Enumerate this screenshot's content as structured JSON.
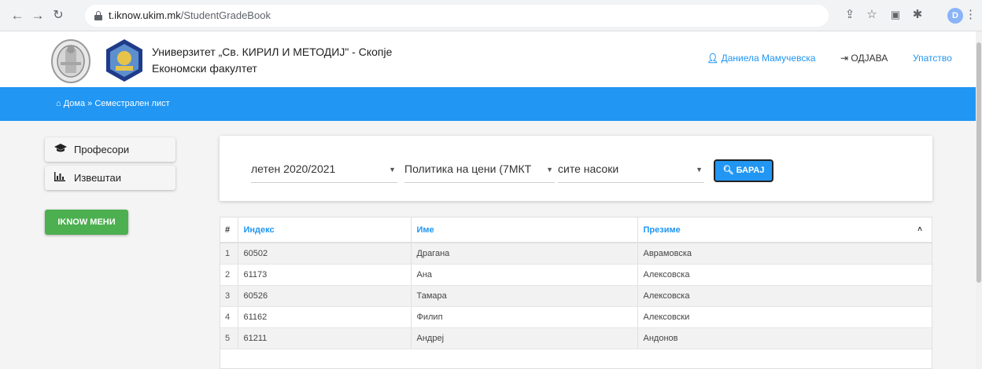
{
  "browser": {
    "url_host": "t.iknow.ukim.mk",
    "url_path": "/StudentGradeBook",
    "profile_letter": "D"
  },
  "header": {
    "university": "Универзитет „Св. КИРИЛ И МЕТОДИЈ\" - Скопје",
    "faculty": "Економски факултет",
    "user": "Даниела Мамучевска",
    "logout": "ОДЈАВА",
    "manual": "Упатство"
  },
  "breadcrumb": {
    "home": "Дома",
    "separator": "»",
    "current": "Семестрален лист"
  },
  "sidebar": {
    "items": [
      {
        "label": "Професори",
        "icon": "graduation-cap-icon"
      },
      {
        "label": "Извештаи",
        "icon": "bar-chart-icon"
      }
    ],
    "iknow_menu": "IKNOW МЕНИ"
  },
  "filters": {
    "semester": "летен 2020/2021",
    "subject": "Политика на цени (7МКТ",
    "direction": "сите насоки",
    "search_label": "БАРАЈ"
  },
  "table": {
    "headers": {
      "num": "#",
      "index": "Индекс",
      "name": "Име",
      "surname": "Презиме"
    },
    "rows": [
      {
        "num": "1",
        "index": "60502",
        "name": "Драгана",
        "surname": "Аврамовска"
      },
      {
        "num": "2",
        "index": "61173",
        "name": "Ана",
        "surname": "Алексовска"
      },
      {
        "num": "3",
        "index": "60526",
        "name": "Тамара",
        "surname": "Алексовска"
      },
      {
        "num": "4",
        "index": "61162",
        "name": "Филип",
        "surname": "Алексовски"
      },
      {
        "num": "5",
        "index": "61211",
        "name": "Андреј",
        "surname": "Андонов"
      }
    ]
  },
  "colors": {
    "primary": "#2196f3",
    "success": "#4caf50"
  }
}
